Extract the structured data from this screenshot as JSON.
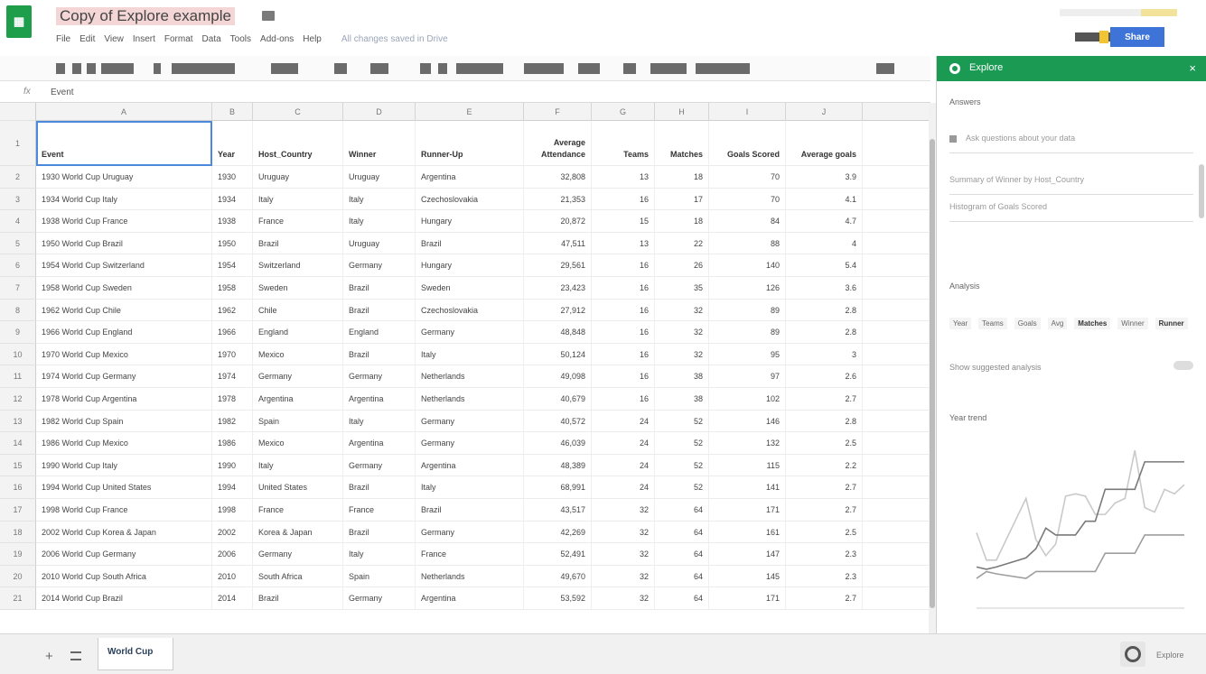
{
  "app": {
    "title": "Copy of Explore example",
    "logo": "sheets-icon",
    "menu": [
      "File",
      "Edit",
      "View",
      "Insert",
      "Format",
      "Data",
      "Tools",
      "Add-ons",
      "Help"
    ],
    "last_edit": "All changes saved in Drive",
    "share_label": "Share",
    "accent": "#1b9a54",
    "share_color": "#3e74d8"
  },
  "formula": {
    "fx_label": "fx",
    "content": "Event"
  },
  "grid": {
    "columns": [
      "A",
      "B",
      "C",
      "D",
      "E",
      "F",
      "G",
      "H",
      "I",
      "J"
    ],
    "headers": [
      "Event",
      "Year",
      "Host_Country",
      "Winner",
      "Runner-Up",
      "Average Attendance",
      "Teams",
      "Matches",
      "Goals Scored",
      "Average goals"
    ],
    "rows": [
      [
        "1930 World Cup Uruguay",
        "1930",
        "Uruguay",
        "Uruguay",
        "Argentina",
        "32,808",
        "13",
        "18",
        "70",
        "3.9"
      ],
      [
        "1934 World Cup Italy",
        "1934",
        "Italy",
        "Italy",
        "Czechoslovakia",
        "21,353",
        "16",
        "17",
        "70",
        "4.1"
      ],
      [
        "1938 World Cup France",
        "1938",
        "France",
        "Italy",
        "Hungary",
        "20,872",
        "15",
        "18",
        "84",
        "4.7"
      ],
      [
        "1950 World Cup Brazil",
        "1950",
        "Brazil",
        "Uruguay",
        "Brazil",
        "47,511",
        "13",
        "22",
        "88",
        "4"
      ],
      [
        "1954 World Cup Switzerland",
        "1954",
        "Switzerland",
        "Germany",
        "Hungary",
        "29,561",
        "16",
        "26",
        "140",
        "5.4"
      ],
      [
        "1958 World Cup Sweden",
        "1958",
        "Sweden",
        "Brazil",
        "Sweden",
        "23,423",
        "16",
        "35",
        "126",
        "3.6"
      ],
      [
        "1962 World Cup Chile",
        "1962",
        "Chile",
        "Brazil",
        "Czechoslovakia",
        "27,912",
        "16",
        "32",
        "89",
        "2.8"
      ],
      [
        "1966 World Cup England",
        "1966",
        "England",
        "England",
        "Germany",
        "48,848",
        "16",
        "32",
        "89",
        "2.8"
      ],
      [
        "1970 World Cup Mexico",
        "1970",
        "Mexico",
        "Brazil",
        "Italy",
        "50,124",
        "16",
        "32",
        "95",
        "3"
      ],
      [
        "1974 World Cup Germany",
        "1974",
        "Germany",
        "Germany",
        "Netherlands",
        "49,098",
        "16",
        "38",
        "97",
        "2.6"
      ],
      [
        "1978 World Cup Argentina",
        "1978",
        "Argentina",
        "Argentina",
        "Netherlands",
        "40,679",
        "16",
        "38",
        "102",
        "2.7"
      ],
      [
        "1982 World Cup Spain",
        "1982",
        "Spain",
        "Italy",
        "Germany",
        "40,572",
        "24",
        "52",
        "146",
        "2.8"
      ],
      [
        "1986 World Cup Mexico",
        "1986",
        "Mexico",
        "Argentina",
        "Germany",
        "46,039",
        "24",
        "52",
        "132",
        "2.5"
      ],
      [
        "1990 World Cup Italy",
        "1990",
        "Italy",
        "Germany",
        "Argentina",
        "48,389",
        "24",
        "52",
        "115",
        "2.2"
      ],
      [
        "1994 World Cup United States",
        "1994",
        "United States",
        "Brazil",
        "Italy",
        "68,991",
        "24",
        "52",
        "141",
        "2.7"
      ],
      [
        "1998 World Cup France",
        "1998",
        "France",
        "France",
        "Brazil",
        "43,517",
        "32",
        "64",
        "171",
        "2.7"
      ],
      [
        "2002 World Cup Korea & Japan",
        "2002",
        "Korea & Japan",
        "Brazil",
        "Germany",
        "42,269",
        "32",
        "64",
        "161",
        "2.5"
      ],
      [
        "2006 World Cup Germany",
        "2006",
        "Germany",
        "Italy",
        "France",
        "52,491",
        "32",
        "64",
        "147",
        "2.3"
      ],
      [
        "2010 World Cup South Africa",
        "2010",
        "South Africa",
        "Spain",
        "Netherlands",
        "49,670",
        "32",
        "64",
        "145",
        "2.3"
      ],
      [
        "2014 World Cup Brazil",
        "2014",
        "Brazil",
        "Germany",
        "Argentina",
        "53,592",
        "32",
        "64",
        "171",
        "2.7"
      ]
    ]
  },
  "sheet_tab": "World Cup",
  "explore": {
    "title": "Explore",
    "section_answers": "Answers",
    "question_placeholder": "Ask questions about your data",
    "question_2": "Summary of Winner by Host_Country",
    "question_3": "Histogram of Goals Scored",
    "section_analysis": "Analysis",
    "chips": [
      "Year",
      "Teams",
      "Goals",
      "Avg",
      "Matches",
      "Winner",
      "Runner"
    ],
    "toggle_label": "Show suggested analysis",
    "section_chart": "Year trend"
  },
  "footer": {
    "explore_label": "Explore"
  },
  "chart_data": {
    "type": "line",
    "series": [
      {
        "name": "",
        "values": [
          33,
          21,
          21,
          48,
          30,
          23,
          28,
          49,
          50,
          49,
          41,
          41,
          46,
          48,
          69,
          44,
          42,
          52,
          50,
          54
        ]
      },
      {
        "name": "",
        "values": [
          13,
          16,
          15,
          13,
          16,
          16,
          16,
          16,
          16,
          16,
          16,
          24,
          24,
          24,
          24,
          32,
          32,
          32,
          32,
          32
        ]
      },
      {
        "name": "",
        "values": [
          18,
          17,
          18,
          22,
          26,
          35,
          32,
          32,
          32,
          38,
          38,
          52,
          52,
          52,
          52,
          64,
          64,
          64,
          64,
          64
        ]
      }
    ],
    "x": [
      1930,
      1934,
      1938,
      1950,
      1954,
      1958,
      1962,
      1966,
      1970,
      1974,
      1978,
      1982,
      1986,
      1990,
      1994,
      1998,
      2002,
      2006,
      2010,
      2014
    ],
    "ylim": [
      0,
      75
    ],
    "grid": false
  }
}
